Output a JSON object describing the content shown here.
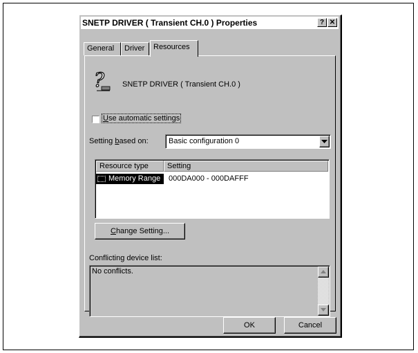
{
  "dialog": {
    "title": "SNETP DRIVER ( Transient CH.0 ) Properties",
    "help_button": "?",
    "close_button": "✕"
  },
  "tabs": [
    {
      "label": "General"
    },
    {
      "label": "Driver"
    },
    {
      "label": "Resources",
      "active": true
    }
  ],
  "resources": {
    "device_name": "SNETP DRIVER ( Transient CH.0 )",
    "use_automatic": {
      "pre": "",
      "key": "U",
      "post": "se automatic settings",
      "checked": false
    },
    "setting_based_on": {
      "pre": "Setting ",
      "key": "b",
      "post": "ased on:",
      "value": "Basic configuration 0"
    },
    "table": {
      "columns": [
        "Resource type",
        "Setting"
      ],
      "rows": [
        {
          "type": "Memory Range",
          "setting": "000DA000 - 000DAFFF",
          "selected": true
        }
      ]
    },
    "change_setting": {
      "key": "C",
      "post": "hange Setting..."
    },
    "conflicting_label": "Conflicting device list:",
    "conflicting_text": "No conflicts."
  },
  "buttons": {
    "ok": "OK",
    "cancel": "Cancel"
  },
  "icons": {
    "device": "question-mark-device-icon",
    "dropdown": "dropdown-arrow-icon"
  },
  "colors": {
    "face": "#c0c0c0",
    "selection": "#000000",
    "window": "#ffffff"
  }
}
